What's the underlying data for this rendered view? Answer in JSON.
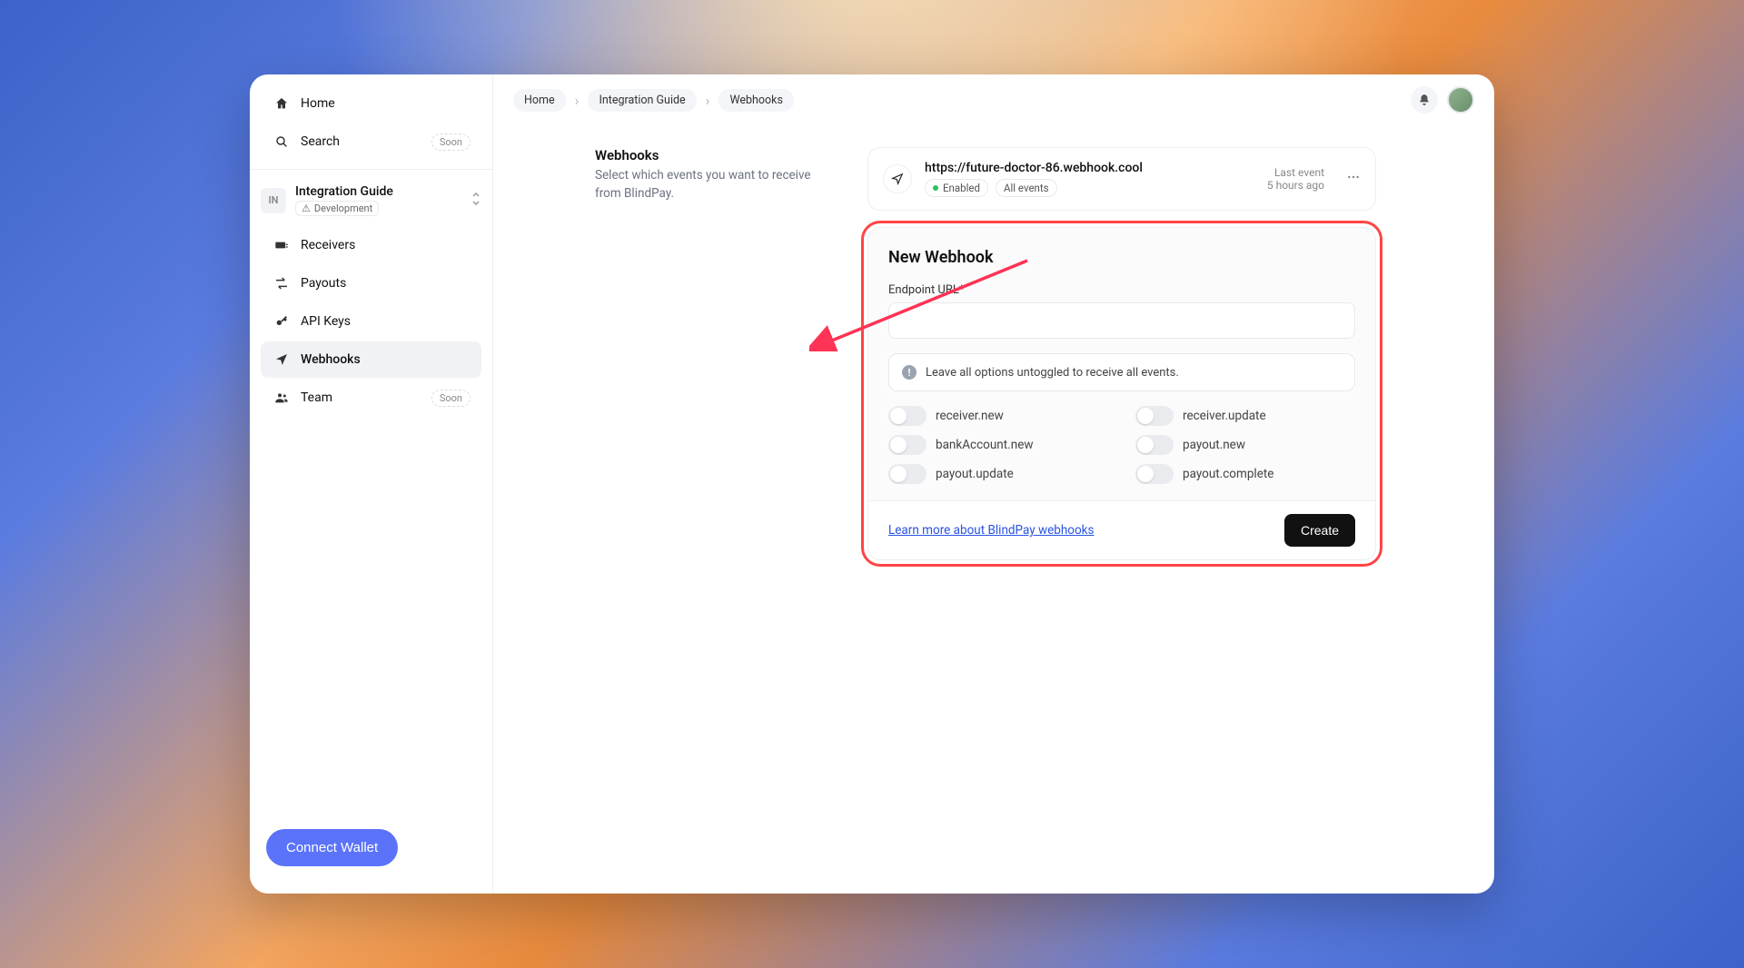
{
  "sidebar": {
    "home_label": "Home",
    "search_label": "Search",
    "search_soon": "Soon",
    "project": {
      "abbr": "IN",
      "name": "Integration Guide",
      "env": "Development"
    },
    "nav": {
      "receivers": "Receivers",
      "payouts": "Payouts",
      "api_keys": "API Keys",
      "webhooks": "Webhooks",
      "team": "Team",
      "team_soon": "Soon"
    },
    "connect_wallet": "Connect Wallet"
  },
  "breadcrumbs": [
    "Home",
    "Integration Guide",
    "Webhooks"
  ],
  "header": {
    "title": "Webhooks",
    "subtitle": "Select which events you want to receive from BlindPay."
  },
  "existing_webhook": {
    "url": "https://future-doctor-86.webhook.cool",
    "status": "Enabled",
    "scope": "All events",
    "last_event_label": "Last event",
    "last_event_value": "5 hours ago"
  },
  "form": {
    "title": "New Webhook",
    "endpoint_label": "Endpoint URL*",
    "endpoint_value": "",
    "info_text": "Leave all options untoggled to receive all events.",
    "events": {
      "receiver_new": "receiver.new",
      "receiver_update": "receiver.update",
      "bankaccount_new": "bankAccount.new",
      "payout_new": "payout.new",
      "payout_update": "payout.update",
      "payout_complete": "payout.complete"
    },
    "learn_more": "Learn more about BlindPay webhooks",
    "create": "Create"
  }
}
